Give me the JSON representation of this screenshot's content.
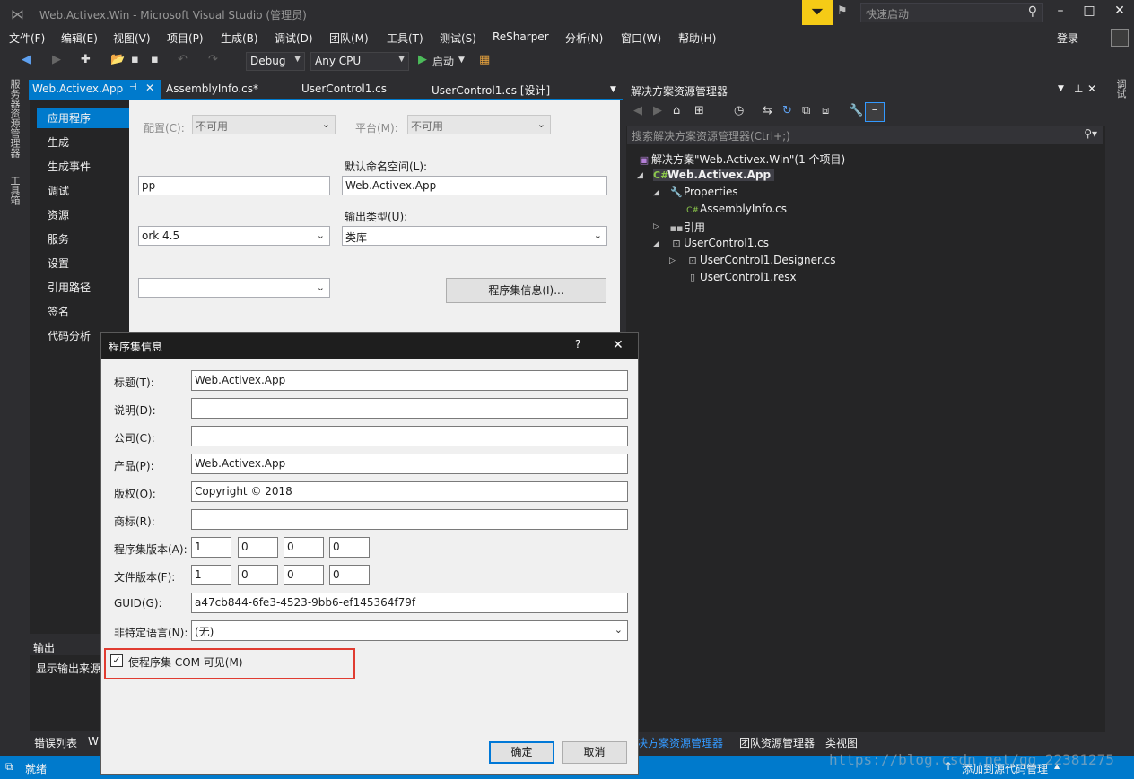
{
  "window": {
    "title": "Web.Activex.Win - Microsoft Visual Studio (管理员)",
    "quick_launch_placeholder": "快速启动"
  },
  "menu": [
    "文件(F)",
    "编辑(E)",
    "视图(V)",
    "项目(P)",
    "生成(B)",
    "调试(D)",
    "团队(M)",
    "工具(T)",
    "测试(S)",
    "ReSharper",
    "分析(N)",
    "窗口(W)",
    "帮助(H)"
  ],
  "login": "登录",
  "toolbar": {
    "config": "Debug",
    "platform": "Any CPU",
    "start": "启动"
  },
  "left_strip": [
    "服务器资源管理器",
    "工具箱"
  ],
  "right_strip": "调试",
  "tabs": [
    {
      "label": "Web.Activex.App"
    },
    {
      "label": "AssemblyInfo.cs*"
    },
    {
      "label": "UserControl1.cs"
    },
    {
      "label": "UserControl1.cs [设计]"
    }
  ],
  "prop_nav": [
    "应用程序",
    "生成",
    "生成事件",
    "调试",
    "资源",
    "服务",
    "设置",
    "引用路径",
    "签名",
    "代码分析"
  ],
  "prop": {
    "config_label": "配置(C):",
    "config_value": "不可用",
    "platform_label": "平台(M):",
    "platform_value": "不可用",
    "assembly_name_partial": "pp",
    "namespace_label": "默认命名空间(L):",
    "namespace_value": "Web.Activex.App",
    "framework_partial": "ork 4.5",
    "output_type_label": "输出类型(U):",
    "output_type_value": "类库",
    "assembly_info_button": "程序集信息(I)..."
  },
  "output": {
    "title": "输出",
    "source_label": "显示输出来源"
  },
  "bottom_tabs": [
    "错误列表",
    "W"
  ],
  "solution_explorer": {
    "title": "解决方案资源管理器",
    "search_placeholder": "搜索解决方案资源管理器(Ctrl+;)",
    "tree": [
      "解决方案\"Web.Activex.Win\"(1 个项目)",
      "Web.Activex.App",
      "Properties",
      "AssemblyInfo.cs",
      "引用",
      "UserControl1.cs",
      "UserControl1.Designer.cs",
      "UserControl1.resx"
    ],
    "bottom_tabs": [
      "解决方案资源管理器",
      "团队资源管理器",
      "类视图"
    ]
  },
  "status": {
    "ready": "就绪",
    "source_control": "添加到源代码管理"
  },
  "watermark": "https://blog.csdn.net/qq_22381275",
  "dialog": {
    "title": "程序集信息",
    "help": "?",
    "close": "✕",
    "fields": [
      {
        "label": "标题(T):",
        "value": "Web.Activex.App"
      },
      {
        "label": "说明(D):",
        "value": ""
      },
      {
        "label": "公司(C):",
        "value": ""
      },
      {
        "label": "产品(P):",
        "value": "Web.Activex.App"
      },
      {
        "label": "版权(O):",
        "value": "Copyright ©  2018"
      },
      {
        "label": "商标(R):",
        "value": ""
      }
    ],
    "assembly_version_label": "程序集版本(A):",
    "assembly_version": [
      "1",
      "0",
      "0",
      "0"
    ],
    "file_version_label": "文件版本(F):",
    "file_version": [
      "1",
      "0",
      "0",
      "0"
    ],
    "guid_label": "GUID(G):",
    "guid": "a47cb844-6fe3-4523-9bb6-ef145364f79f",
    "neutral_lang_label": "非特定语言(N):",
    "neutral_lang": "(无)",
    "com_visible_label": "使程序集 COM 可见(M)",
    "com_visible_checked": true,
    "ok": "确定",
    "cancel": "取消"
  }
}
